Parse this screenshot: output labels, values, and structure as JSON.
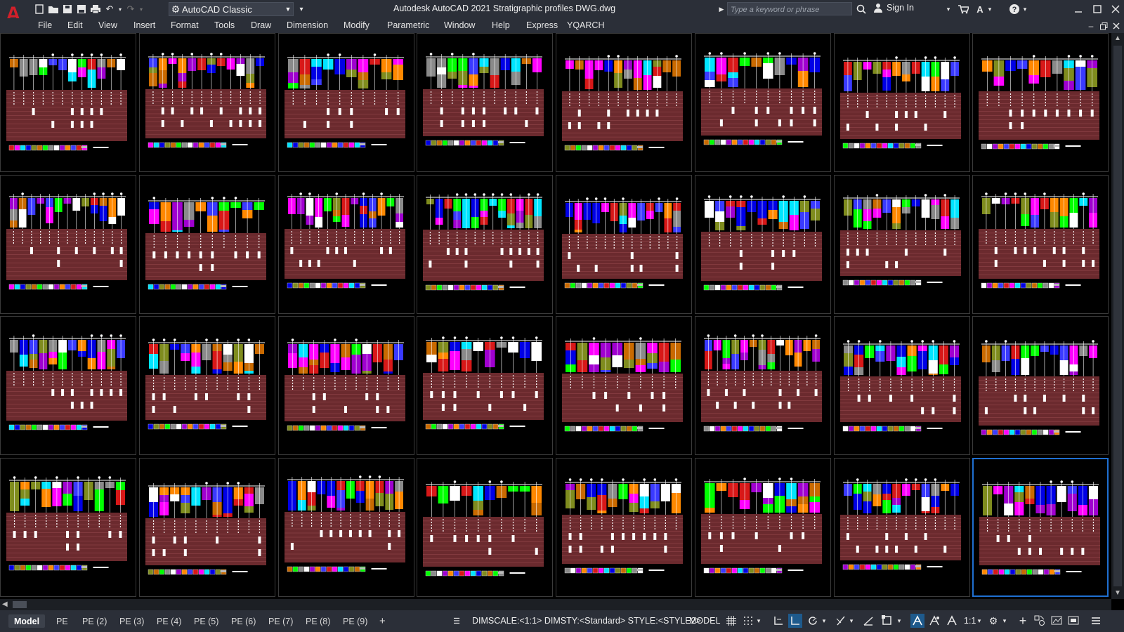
{
  "app": {
    "logo_letter": "A",
    "title": "Autodesk AutoCAD 2021    Stratigraphic profiles DWG.dwg",
    "workspace": "AutoCAD Classic",
    "search_placeholder": "Type a keyword or phrase",
    "sign_in": "Sign In"
  },
  "menu": [
    "File",
    "Edit",
    "View",
    "Insert",
    "Format",
    "Tools",
    "Draw",
    "Dimension",
    "Modify",
    "Parametric",
    "Window",
    "Help",
    "Express",
    "YQARCH"
  ],
  "tabs": [
    "Model",
    "PE",
    "PE (2)",
    "PE (3)",
    "PE (4)",
    "PE (5)",
    "PE (6)",
    "PE (7)",
    "PE (8)",
    "PE (9)"
  ],
  "active_tab": "Model",
  "add_tab": "+",
  "status": {
    "command_line": "DIMSCALE:<1:1> DIMSTY:<Standard> STYLE:<STYLE2>",
    "space": "MODEL",
    "scale": "1:1"
  },
  "drawing": {
    "rows": 4,
    "columns": 8,
    "selected_sheet": [
      3,
      7
    ],
    "layer_colors": [
      "#d81818",
      "#ff00ff",
      "#00e5ff",
      "#0000e6",
      "#7f8c1e",
      "#c96a00",
      "#00ff00",
      "#8a8a8a",
      "#ffffff",
      "#a000d0",
      "#ff8800",
      "#3a3aff"
    ],
    "table_color": "#6b2a2e"
  },
  "icons": {
    "new": "new-file-icon",
    "open": "open-folder-icon",
    "save": "save-icon",
    "saveas": "save-as-icon",
    "print": "print-icon",
    "undo": "undo-icon",
    "redo": "redo-icon",
    "help": "help-icon",
    "cart": "cart-icon"
  }
}
